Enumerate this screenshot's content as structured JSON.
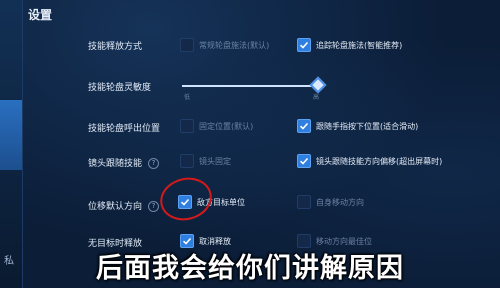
{
  "title": "设置",
  "left_strip_char": "私",
  "rows": [
    {
      "label": "技能释放方式",
      "help": false,
      "options": [
        {
          "text": "常规轮盘施法(默认)",
          "checked": false
        },
        {
          "text": "追踪轮盘施法(智能推荐)",
          "checked": true
        }
      ]
    },
    {
      "label": "技能轮盘灵敏度",
      "help": false,
      "slider": {
        "level_fraction": 0.96,
        "min_label": "低",
        "max_label": "高"
      }
    },
    {
      "label": "技能轮盘呼出位置",
      "help": false,
      "options": [
        {
          "text": "固定位置(默认)",
          "checked": false
        },
        {
          "text": "跟随手指按下位置(适合滑动)",
          "checked": true
        }
      ]
    },
    {
      "label": "镜头跟随技能",
      "help": true,
      "options": [
        {
          "text": "镜头固定",
          "checked": false
        },
        {
          "text": "镜头跟随技能方向偏移(超出屏幕时)",
          "checked": true
        }
      ]
    },
    {
      "label": "位移默认方向",
      "help": true,
      "options": [
        {
          "text": "敌方目标单位",
          "checked": true
        },
        {
          "text": "自身移动方向",
          "checked": false
        }
      ]
    },
    {
      "label": "无目标时释放",
      "help": false,
      "options": [
        {
          "text": "取消释放",
          "checked": true
        },
        {
          "text": "移动方向最佳位",
          "checked": false
        }
      ]
    }
  ],
  "help_glyph": "?",
  "subtitle": "后面我会给你们讲解原因",
  "colors": {
    "accent": "#2f7fe0",
    "annotation": "#d11a1a",
    "background": "#0b1d37"
  }
}
